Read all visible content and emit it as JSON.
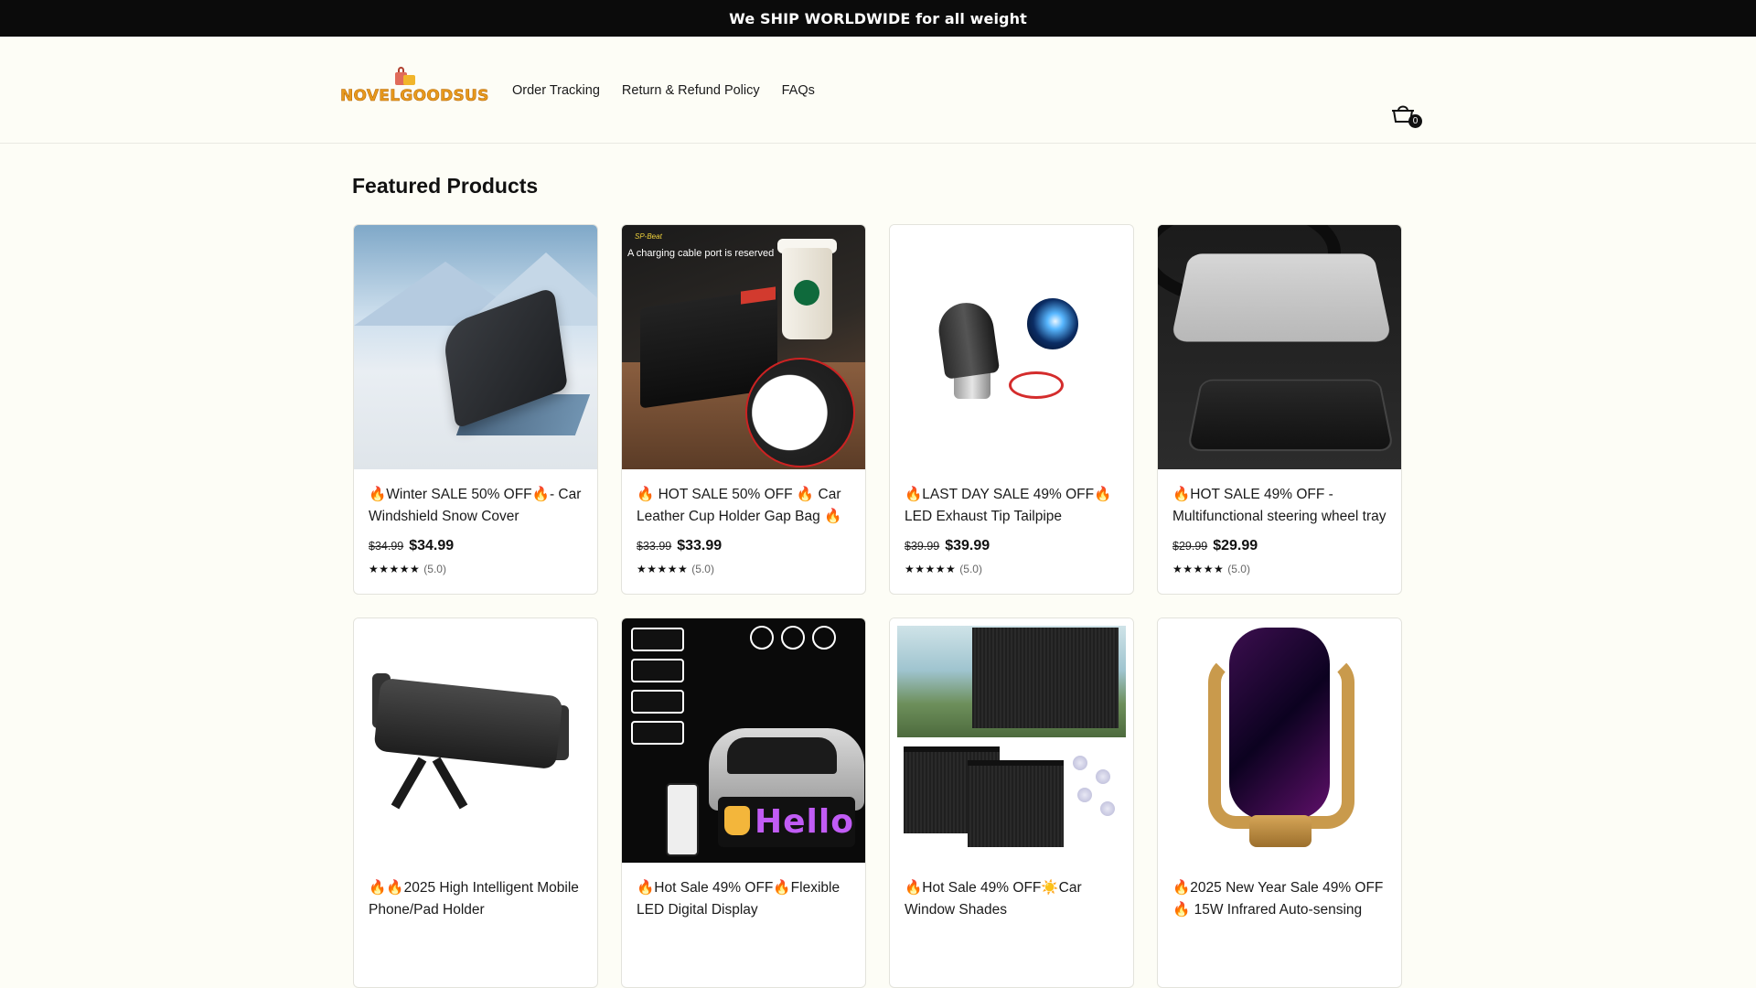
{
  "announcement": "We SHIP WORLDWIDE for all weight",
  "brand": {
    "logo_text": "NOVELGOODSUS"
  },
  "nav": {
    "items": [
      "Order Tracking",
      "Return & Refund Policy",
      "FAQs"
    ]
  },
  "cart": {
    "count": "0"
  },
  "section": {
    "title": "Featured Products"
  },
  "products": [
    {
      "title": "🔥Winter SALE 50% OFF🔥- Car Windshield Snow Cover",
      "old_price": "$34.99",
      "price": "$34.99",
      "stars": "★★★★★",
      "rating": "(5.0)"
    },
    {
      "title": "🔥 HOT SALE 50% OFF 🔥 Car Leather Cup Holder Gap Bag 🔥",
      "old_price": "$33.99",
      "price": "$33.99",
      "stars": "★★★★★",
      "rating": "(5.0)",
      "image_caption": "A charging cable port is reserved",
      "image_brand": "SP-Beat"
    },
    {
      "title": "🔥LAST DAY SALE 49% OFF🔥LED Exhaust Tip Tailpipe",
      "old_price": "$39.99",
      "price": "$39.99",
      "stars": "★★★★★",
      "rating": "(5.0)"
    },
    {
      "title": "🔥HOT SALE 49% OFF - Multifunctional steering wheel tray",
      "old_price": "$29.99",
      "price": "$29.99",
      "stars": "★★★★★",
      "rating": "(5.0)"
    },
    {
      "title": "🔥🔥2025 High Intelligent Mobile Phone/Pad Holder",
      "old_price": "",
      "price": "",
      "stars": "",
      "rating": ""
    },
    {
      "title": "🔥Hot Sale 49% OFF🔥Flexible LED Digital Display",
      "old_price": "",
      "price": "",
      "stars": "",
      "rating": "",
      "image_text": "Hello"
    },
    {
      "title": "🔥Hot Sale 49% OFF☀️Car Window Shades",
      "old_price": "",
      "price": "",
      "stars": "",
      "rating": ""
    },
    {
      "title": "🔥2025 New Year Sale 49% OFF🔥 15W Infrared Auto-sensing",
      "old_price": "",
      "price": "",
      "stars": "",
      "rating": ""
    }
  ],
  "icons": {
    "cart": "cart-icon",
    "star": "star-icon"
  }
}
